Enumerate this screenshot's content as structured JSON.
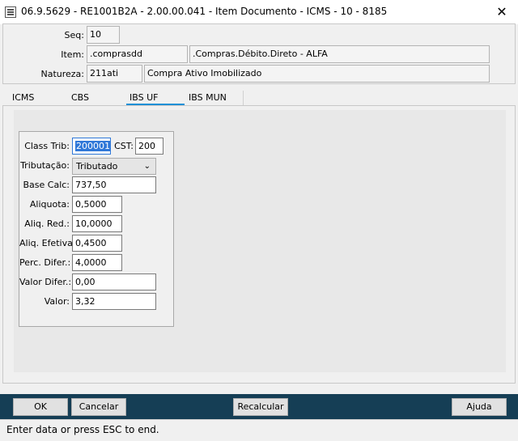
{
  "window": {
    "title": "06.9.5629 - RE1001B2A - 2.00.00.041 - Item Documento - ICMS - 10 - 8185",
    "close_glyph": "✕"
  },
  "header": {
    "seq_label": "Seq:",
    "seq_value": "10",
    "item_label": "Item:",
    "item_code": ".comprasdd",
    "item_desc": ".Compras.Débito.Direto - ALFA",
    "natureza_label": "Natureza:",
    "natureza_code": "211ati",
    "natureza_desc": "Compra Ativo Imobilizado"
  },
  "tabs": [
    {
      "label": "ICMS"
    },
    {
      "label": "CBS"
    },
    {
      "label": "IBS UF"
    },
    {
      "label": "IBS MUN"
    }
  ],
  "active_tab": "IBS UF",
  "form": {
    "class_trib_label": "Class Trib:",
    "class_trib_value": "200001",
    "cst_label": "CST:",
    "cst_value": "200",
    "tributacao_label": "Tributação:",
    "tributacao_value": "Tributado",
    "base_calc_label": "Base Calc:",
    "base_calc_value": "737,50",
    "aliquota_label": "Aliquota:",
    "aliquota_value": "0,5000",
    "aliq_red_label": "Aliq. Red.:",
    "aliq_red_value": "10,0000",
    "aliq_efetiva_label": "Aliq. Efetiva:",
    "aliq_efetiva_value": "0,4500",
    "perc_difer_label": "Perc. Difer.:",
    "perc_difer_value": "4,0000",
    "valor_difer_label": "Valor Difer.:",
    "valor_difer_value": "0,00",
    "valor_label": "Valor:",
    "valor_value": "3,32"
  },
  "buttons": {
    "ok": "OK",
    "cancelar": "Cancelar",
    "recalcular": "Recalcular",
    "ajuda": "Ajuda"
  },
  "status": {
    "text": "Enter data or press ESC to end."
  },
  "colors": {
    "accent": "#1e90d6",
    "bottom_bar": "#153e55",
    "selection": "#3078d8"
  }
}
